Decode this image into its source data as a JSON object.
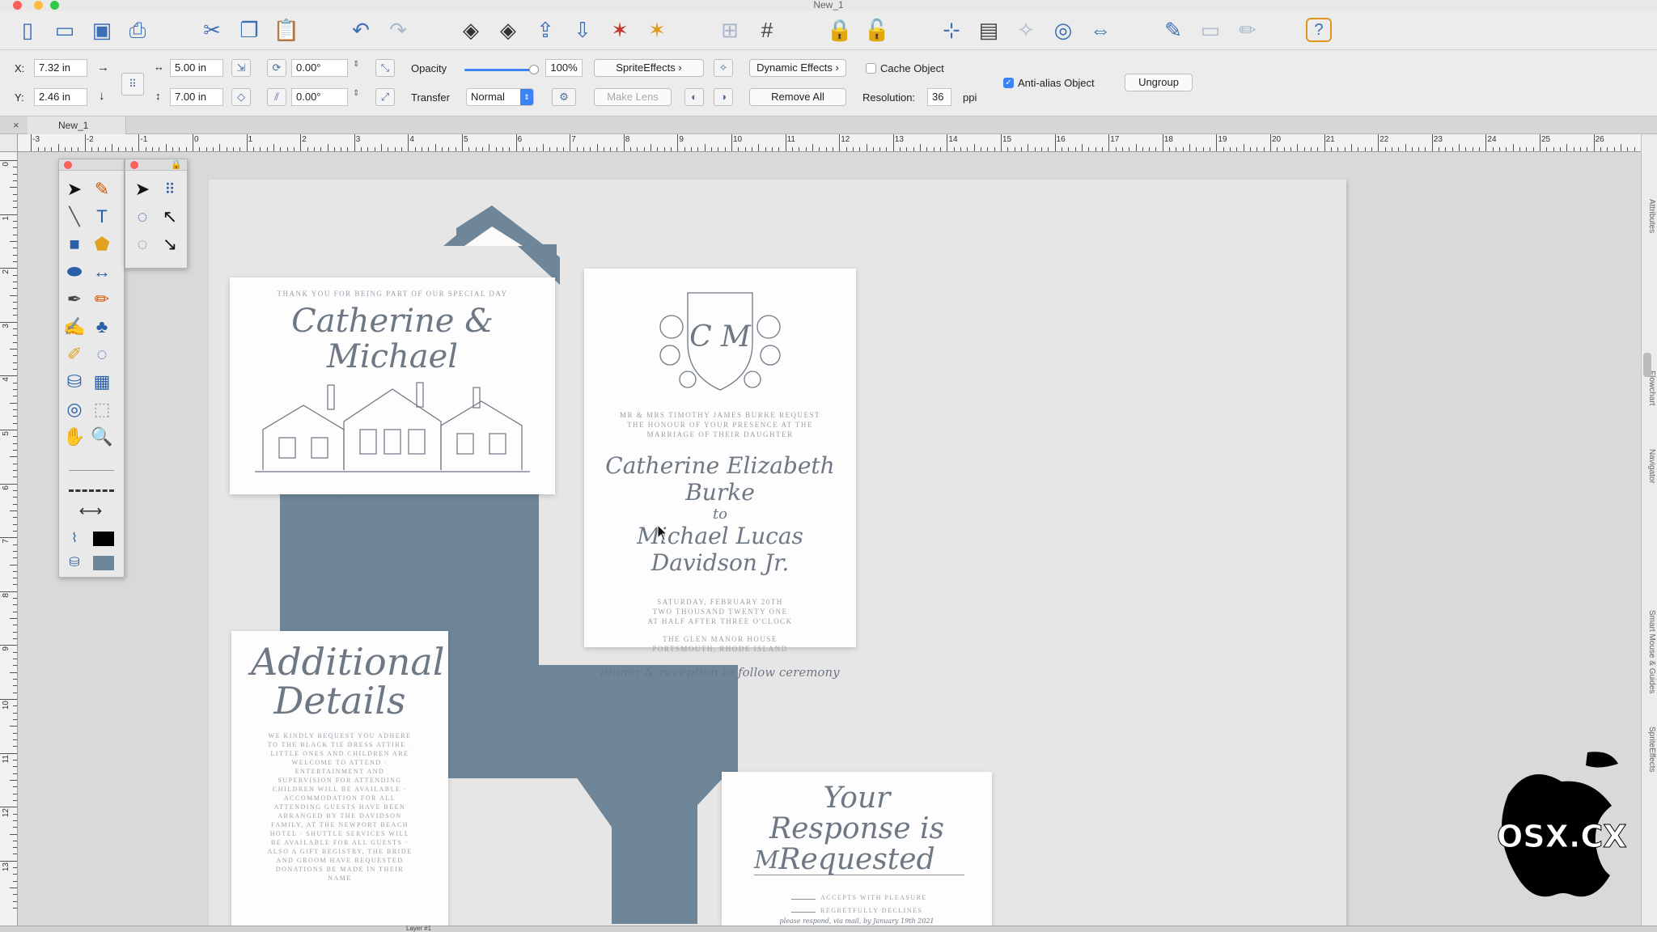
{
  "window": {
    "title": "New_1"
  },
  "toolbar": {
    "icons": [
      "new-document-icon",
      "open-icon",
      "save-icon",
      "print-icon",
      "cut-icon",
      "copy-icon",
      "paste-icon",
      "undo-icon",
      "redo-icon",
      "bring-to-front-icon",
      "send-to-back-icon",
      "bring-forward-icon",
      "send-backward-icon",
      "align-icon",
      "group-icon",
      "grid-icon",
      "table-icon",
      "lock-icon",
      "unlock-icon",
      "show-ruler-icon",
      "ruler-icon",
      "effects-icon",
      "capture-icon",
      "fit-width-icon",
      "edit-icon",
      "display-icon",
      "pencil-icon",
      "help-icon"
    ]
  },
  "props": {
    "x_label": "X:",
    "x_value": "7.32 in",
    "y_label": "Y:",
    "y_value": "2.46 in",
    "width_value": "5.00 in",
    "height_value": "7.00 in",
    "rotation_value": "0.00°",
    "skew_value": "0.00°",
    "opacity_label": "Opacity",
    "opacity_value": "100%",
    "opacity_fraction": 0.95,
    "transfer_label": "Transfer",
    "transfer_value": "Normal",
    "sprite_effects": "SpriteEffects",
    "make_lens": "Make Lens",
    "dynamic_effects": "Dynamic Effects",
    "remove_all": "Remove All",
    "cache_object": "Cache Object",
    "anti_alias": "Anti-alias Object",
    "ungroup": "Ungroup",
    "resolution_label": "Resolution:",
    "resolution_value": "36",
    "resolution_unit": "ppi"
  },
  "tab": {
    "close": "×",
    "name": "New_1"
  },
  "ruler": {
    "h_labels": [
      "-3",
      "-2",
      "-1",
      "0",
      "1",
      "2",
      "3",
      "4",
      "5",
      "6",
      "7",
      "8",
      "9",
      "10",
      "11",
      "12",
      "13",
      "14",
      "15",
      "16",
      "17",
      "18",
      "19",
      "20",
      "21",
      "22",
      "23",
      "24",
      "25",
      "26"
    ],
    "v_labels": [
      "0",
      "1",
      "2",
      "3",
      "4",
      "5",
      "6",
      "7",
      "8",
      "9",
      "10",
      "11",
      "12",
      "13"
    ]
  },
  "cards": {
    "thanks": {
      "top": "THANK YOU FOR BEING PART OF OUR SPECIAL DAY",
      "names": "Catherine & Michael"
    },
    "invite": {
      "monogram": "C M",
      "request": "MR & MRS TIMOTHY JAMES BURKE REQUEST THE HONOUR OF YOUR PRESENCE AT THE MARRIAGE OF THEIR DAUGHTER",
      "bride": "Catherine Elizabeth Burke",
      "to": "to",
      "groom": "Michael Lucas Davidson Jr.",
      "date": "SATURDAY, FEBRUARY 20TH TWO THOUSAND TWENTY ONE AT HALF AFTER THREE O'CLOCK",
      "venue": "THE GLEN MANOR HOUSE PORTSMOUTH, RHODE ISLAND",
      "closing": "dinner & reception to follow ceremony"
    },
    "details": {
      "title": "Additional Details",
      "body": "WE KINDLY REQUEST YOU ADHERE TO THE BLACK TIE DRESS ATTIRE · LITTLE ONES AND CHILDREN ARE WELCOME TO ATTEND · ENTERTAINMENT AND SUPERVISION FOR ATTENDING CHILDREN WILL BE AVAILABLE · ACCOMMODATION FOR ALL ATTENDING GUESTS HAVE BEEN ARRANGED BY THE DAVIDSON FAMILY, AT THE NEWPORT BEACH HOTEL · SHUTTLE SERVICES WILL BE AVAILABLE FOR ALL GUESTS · ALSO A GIFT REGISTRY, THE BRIDE AND GROOM HAVE REQUESTED DONATIONS BE MADE IN THEIR NAME"
    },
    "rsvp": {
      "title": "Your Response is Requested",
      "m": "M",
      "accept": "ACCEPTS WITH PLEASURE",
      "decline": "REGRETFULLY DECLINES",
      "footer": "please respond, via mail, by January 19th 2021"
    }
  },
  "right_panel": {
    "tabs": [
      "Attributes",
      "Flowchart",
      "Navigator",
      "Smart Mouse & Guides",
      "SpriteEffects"
    ]
  },
  "status": {
    "layer": "Layer #1"
  },
  "watermark": {
    "text": "OSX.CX"
  },
  "colors": {
    "envelope": "#6e8698",
    "accent": "#3b6fb6",
    "canvas": "#d9d9d9"
  }
}
